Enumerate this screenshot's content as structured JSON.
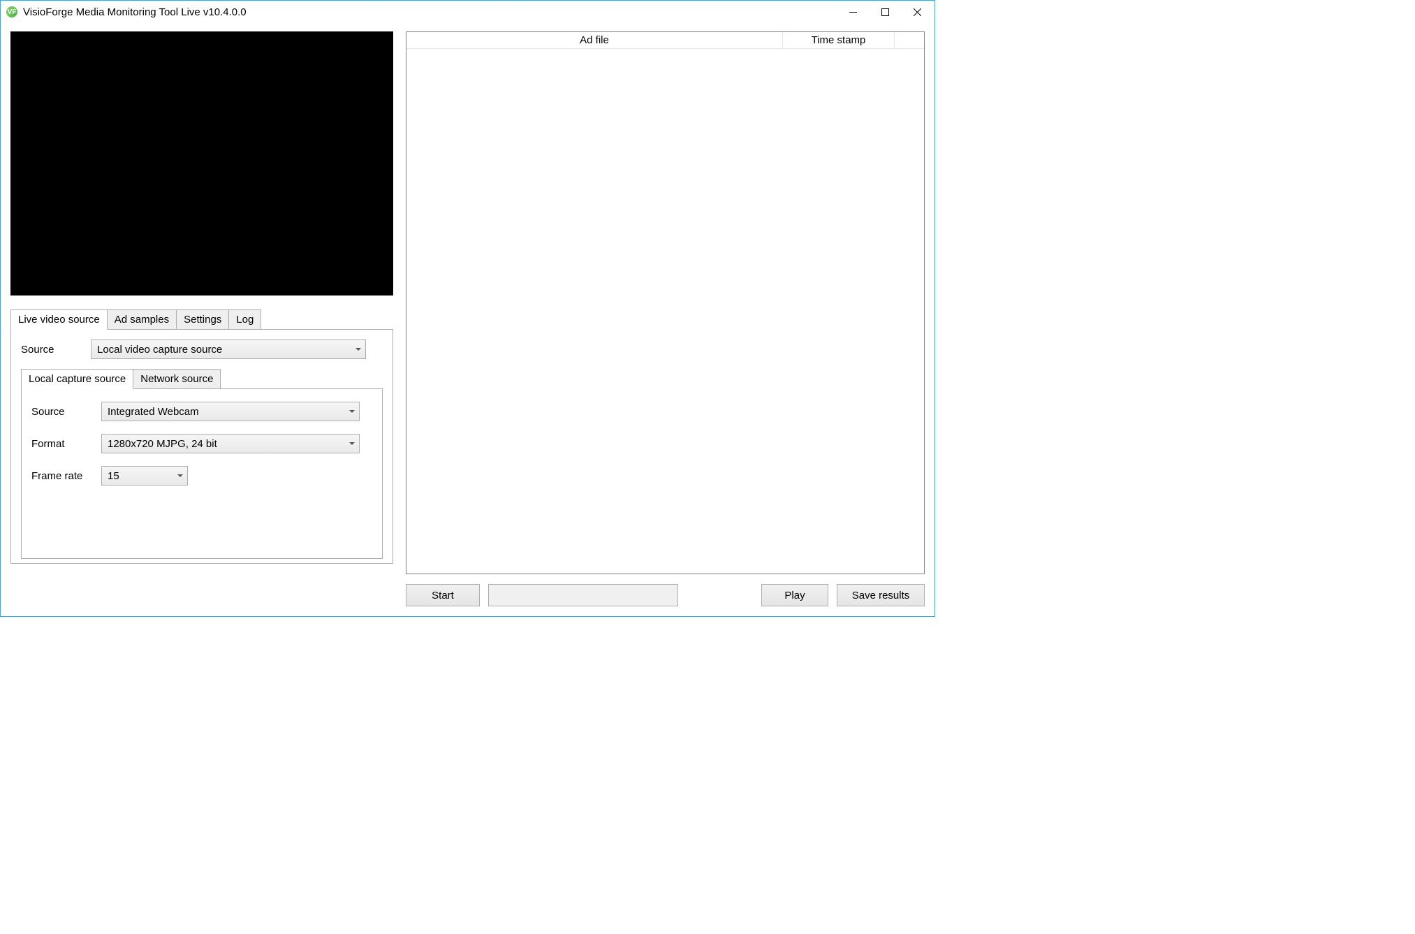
{
  "window": {
    "title": "VisioForge Media Monitoring Tool Live v10.4.0.0",
    "icon_text": "VF"
  },
  "tabs": {
    "main": {
      "live_video_source": "Live video source",
      "ad_samples": "Ad samples",
      "settings": "Settings",
      "log": "Log"
    },
    "sub": {
      "local_capture": "Local capture source",
      "network": "Network source"
    }
  },
  "labels": {
    "source_outer": "Source",
    "source_inner": "Source",
    "format": "Format",
    "frame_rate": "Frame rate"
  },
  "values": {
    "source_type": "Local video capture source",
    "capture_device": "Integrated Webcam",
    "format": "1280x720 MJPG, 24 bit",
    "frame_rate": "15"
  },
  "listview": {
    "columns": {
      "ad_file": "Ad file",
      "time_stamp": "Time stamp"
    }
  },
  "buttons": {
    "start": "Start",
    "play": "Play",
    "save_results": "Save results"
  }
}
